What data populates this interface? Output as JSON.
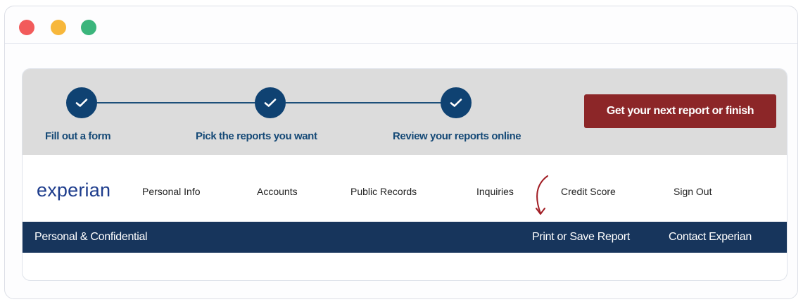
{
  "steps": [
    {
      "label": "Fill out a form"
    },
    {
      "label": "Pick the reports you want"
    },
    {
      "label": "Review your reports online"
    }
  ],
  "next_button": {
    "label": "Get your next report or finish"
  },
  "brand": {
    "logo": "experian"
  },
  "nav": {
    "items": [
      {
        "label": "Personal Info"
      },
      {
        "label": "Accounts"
      },
      {
        "label": "Public Records"
      },
      {
        "label": "Inquiries"
      },
      {
        "label": "Credit Score"
      },
      {
        "label": "Sign Out"
      }
    ]
  },
  "subbar": {
    "left": "Personal & Confidential",
    "print": "Print or Save Report",
    "contact": "Contact Experian"
  },
  "colors": {
    "step": "#0f4272",
    "button": "#8c2628",
    "subbar": "#17355c",
    "annotation": "#a11d24"
  },
  "icons": {
    "step": "check-icon",
    "annotation": "curved-arrow-icon"
  }
}
